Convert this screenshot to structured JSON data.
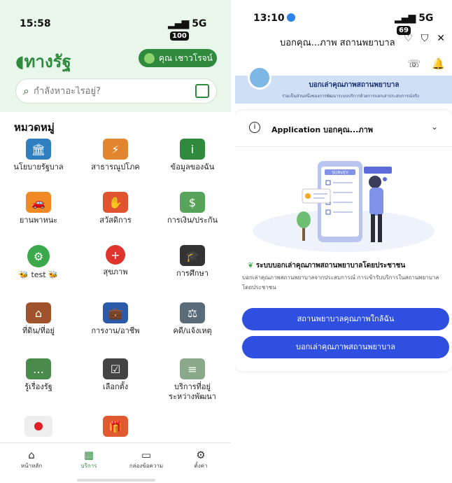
{
  "left_screen": {
    "status": {
      "time": "15:58",
      "network": "5G",
      "battery": "100"
    },
    "logo_text": "ทางรัฐ",
    "user_button": "คุณ เชาวโรจน์",
    "search": {
      "placeholder": "กำลังหาอะไรอยู่?"
    },
    "section_title": "หมวดหมู่",
    "categories": [
      {
        "label": "นโยบายรัฐบาล",
        "icon": "government-building-icon",
        "color": "#2f7fc0"
      },
      {
        "label": "สาธารณูปโภค",
        "icon": "utilities-icon",
        "color": "#e0862f"
      },
      {
        "label": "ข้อมูลของฉัน",
        "icon": "user-info-icon",
        "color": "#2f8a3d"
      },
      {
        "label": "ยานพาหนะ",
        "icon": "car-icon",
        "color": "#f08a24"
      },
      {
        "label": "สวัสดิการ",
        "icon": "hand-icon",
        "color": "#e0532f"
      },
      {
        "label": "การเงิน/ประกัน",
        "icon": "finance-icon",
        "color": "#58a35a"
      },
      {
        "label": "test",
        "icon": "gear-icon",
        "color": "#3aa84b"
      },
      {
        "label": "สุขภาพ",
        "icon": "health-cross-icon",
        "color": "#e0342f"
      },
      {
        "label": "การศึกษา",
        "icon": "graduation-cap-icon",
        "color": "#333333"
      },
      {
        "label": "ที่ดิน/ที่อยู่",
        "icon": "house-icon",
        "color": "#a0522d"
      },
      {
        "label": "การงาน/อาชีพ",
        "icon": "briefcase-icon",
        "color": "#2b5aa8"
      },
      {
        "label": "คดี/แจ้งเหตุ",
        "icon": "scales-icon",
        "color": "#5a6b7a"
      },
      {
        "label": "รู้เรื่องรัฐ",
        "icon": "message-icon",
        "color": "#4a8a4a"
      },
      {
        "label": "เลือกตั้ง",
        "icon": "vote-box-icon",
        "color": "#444444"
      },
      {
        "label": "บริการที่อยู่ระหว่างพัฒนา",
        "icon": "server-icon",
        "color": "#8aa88a"
      },
      {
        "label": "",
        "icon": "japan-flag-icon",
        "color": "#dddddd"
      },
      {
        "label": "",
        "icon": "gift-icon",
        "color": "#e05a2f"
      }
    ],
    "tabs": [
      {
        "label": "หน้าหลัก",
        "icon": "home-icon"
      },
      {
        "label": "บริการ",
        "icon": "grid-icon"
      },
      {
        "label": "กล่องข้อความ",
        "icon": "inbox-icon"
      },
      {
        "label": "ตั้งค่า",
        "icon": "gear-icon"
      }
    ]
  },
  "right_screen": {
    "status": {
      "time": "13:10",
      "network": "5G",
      "battery": "69"
    },
    "nav_title": "บอกคุณ...ภาพ สถานพยาบาล",
    "banner_title": "บอกเล่าคุณภาพสถานพยาบาล",
    "banner_subtitle": "ร่วมเป็นส่วนหนึ่งของการพัฒนาระบบบริการด้วยการบอกเล่าประสบการณ์จริง",
    "app_header": "Application บอกคุณ...ภาพ",
    "illustration_text": "SURVEY",
    "desc_title": "ระบบบอกเล่าคุณภาพสถานพยาบาลโดยประชาชน",
    "desc_body": "บอกเล่าคุณภาพสถานพยาบาลจากประสบการณ์ การเข้ารับบริการในสถานพยาบาล โดยประชาชน",
    "btn_nearby": "สถานพยาบาลคุณภาพใกล้ฉัน",
    "btn_report": "บอกเล่าคุณภาพสถานพยาบาล"
  },
  "colors": {
    "green": "#2f8a3d",
    "blue_button": "#2e4fe0"
  }
}
